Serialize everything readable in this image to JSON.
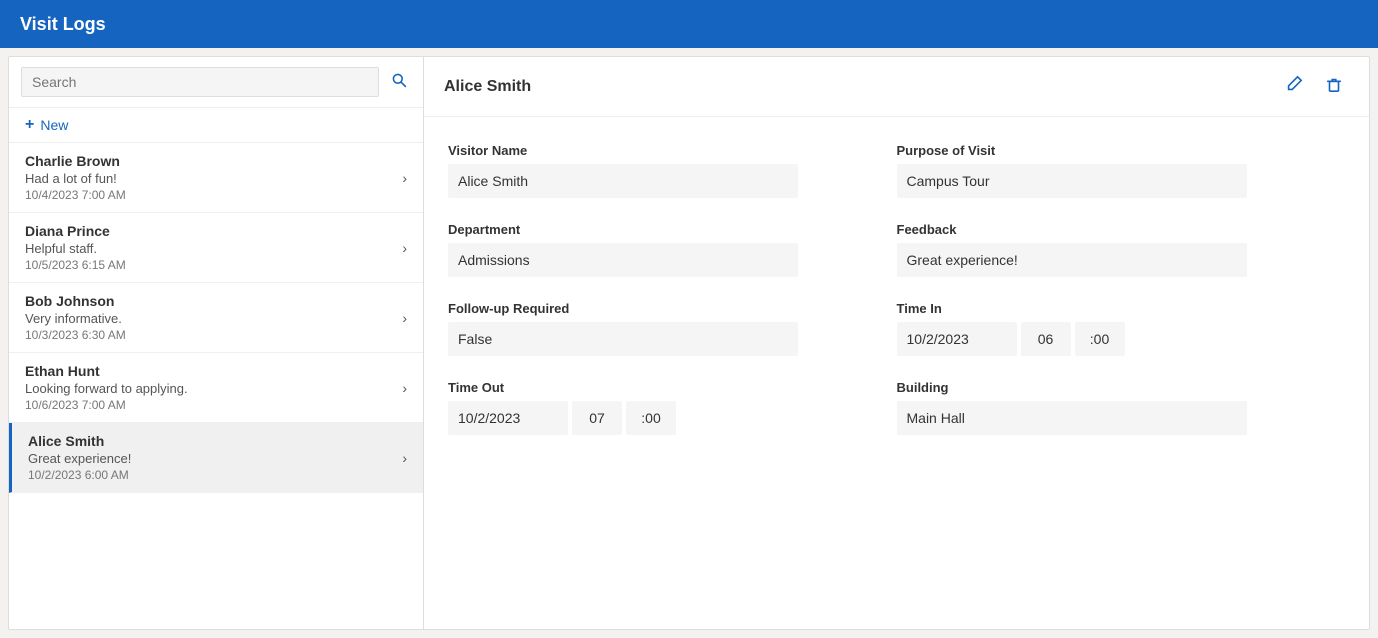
{
  "header": {
    "title": "Visit Logs"
  },
  "left_panel": {
    "search": {
      "placeholder": "Search",
      "value": ""
    },
    "new_button_label": "New",
    "list_items": [
      {
        "id": "charlie-brown",
        "name": "Charlie Brown",
        "feedback": "Had a lot of fun!",
        "date": "10/4/2023 7:00 AM",
        "active": false
      },
      {
        "id": "diana-prince",
        "name": "Diana Prince",
        "feedback": "Helpful staff.",
        "date": "10/5/2023 6:15 AM",
        "active": false
      },
      {
        "id": "bob-johnson",
        "name": "Bob Johnson",
        "feedback": "Very informative.",
        "date": "10/3/2023 6:30 AM",
        "active": false
      },
      {
        "id": "ethan-hunt",
        "name": "Ethan Hunt",
        "feedback": "Looking forward to applying.",
        "date": "10/6/2023 7:00 AM",
        "active": false
      },
      {
        "id": "alice-smith",
        "name": "Alice Smith",
        "feedback": "Great experience!",
        "date": "10/2/2023 6:00 AM",
        "active": true
      }
    ]
  },
  "detail": {
    "title": "Alice Smith",
    "fields": {
      "visitor_name_label": "Visitor Name",
      "visitor_name_value": "Alice Smith",
      "purpose_label": "Purpose of Visit",
      "purpose_value": "Campus Tour",
      "department_label": "Department",
      "department_value": "Admissions",
      "feedback_label": "Feedback",
      "feedback_value": "Great experience!",
      "followup_label": "Follow-up Required",
      "followup_value": "False",
      "time_in_label": "Time In",
      "time_in_date": "10/2/2023",
      "time_in_hour": "06",
      "time_in_min": ":00",
      "time_out_label": "Time Out",
      "time_out_date": "10/2/2023",
      "time_out_hour": "07",
      "time_out_min": ":00",
      "building_label": "Building",
      "building_value": "Main Hall"
    },
    "edit_icon": "✏",
    "delete_icon": "🗑"
  },
  "icons": {
    "search": "🔍",
    "plus": "+",
    "chevron_right": "›",
    "edit": "✏",
    "delete": "🗑"
  }
}
